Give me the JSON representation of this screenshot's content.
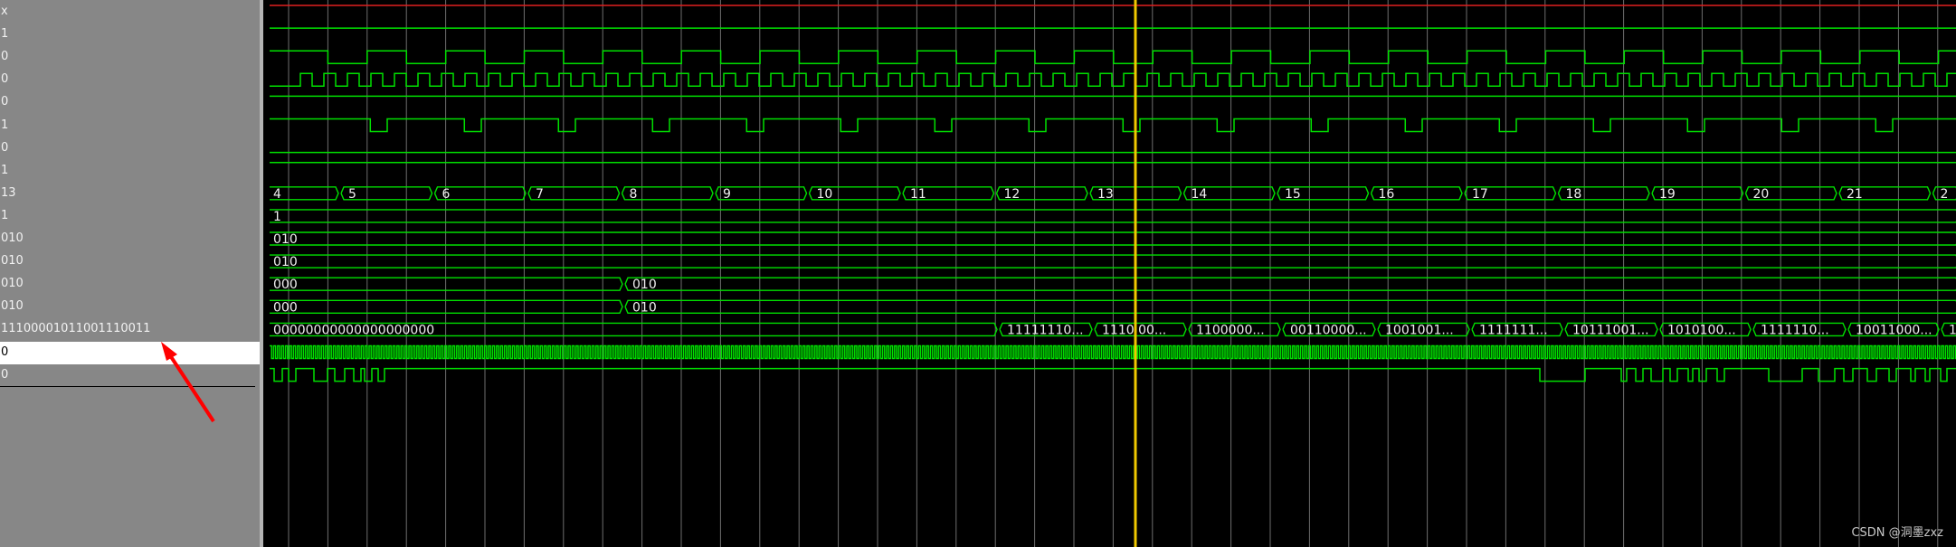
{
  "values": [
    "x",
    "1",
    "0",
    "0",
    "0",
    "1",
    "0",
    "1",
    "13",
    "1",
    "010",
    "010",
    "010",
    "010",
    "11100001011001110011",
    "0",
    "0"
  ],
  "selected_row": 15,
  "bus_counter": {
    "labels": [
      "4",
      "5",
      "6",
      "7",
      "8",
      "9",
      "10",
      "11",
      "12",
      "13",
      "14",
      "15",
      "16",
      "17",
      "18",
      "19",
      "20",
      "21",
      "2"
    ]
  },
  "bus_rows": [
    {
      "segments": [
        "1"
      ]
    },
    {
      "segments": [
        "010"
      ]
    },
    {
      "segments": [
        "010"
      ]
    },
    {
      "segments": [
        "000",
        "010"
      ]
    },
    {
      "segments": [
        "000",
        "010"
      ]
    },
    {
      "segments": [
        "00000000000000000000",
        "11111110...",
        "1110 00...",
        "1100000...",
        "00110000...",
        "1001001...",
        "1111111...",
        "10111001...",
        "1010100...",
        "1111110...",
        "10011000...",
        "1"
      ]
    }
  ],
  "watermark": "CSDN @洞墨zxz",
  "colors": {
    "wave": "#00e000",
    "cursor": "#f0c800",
    "top_signal": "#e02020",
    "arrow": "#ff0000",
    "panel": "#878787",
    "grid": "#6e6e6e"
  }
}
